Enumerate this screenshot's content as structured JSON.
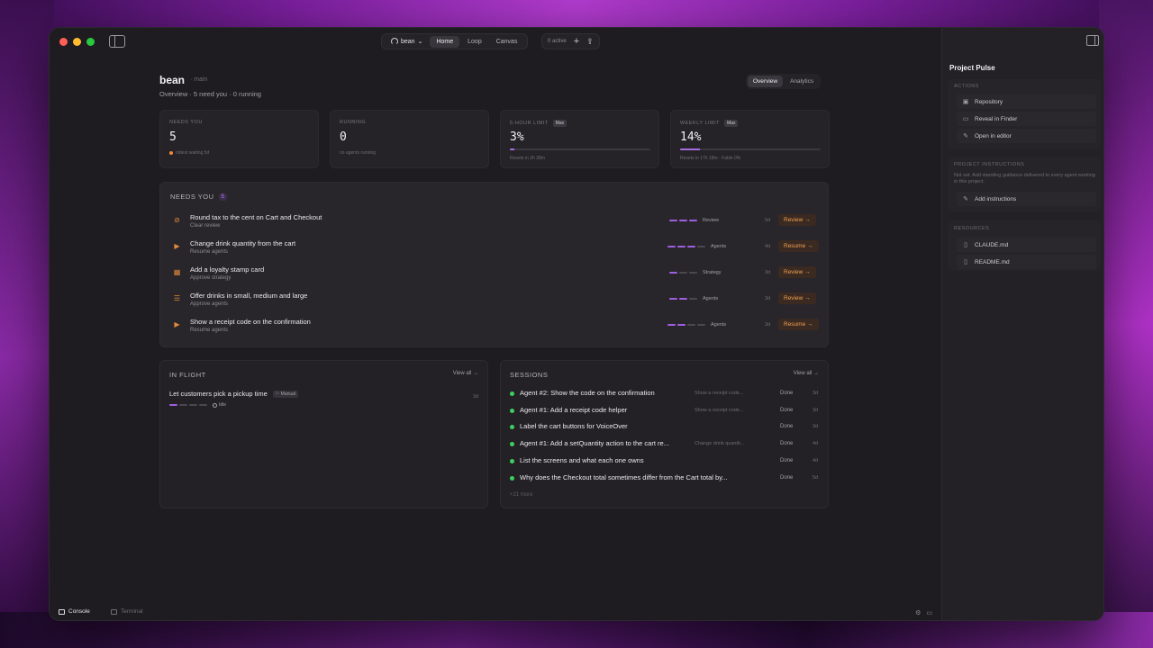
{
  "window": {
    "project": "bean",
    "tabs": [
      "Home",
      "Loop",
      "Canvas"
    ],
    "active_tab": "Home",
    "active_count": "0 active"
  },
  "header": {
    "title": "bean",
    "branch": "· main",
    "subtitle": "Overview · 5 need you · 0 running",
    "segments": [
      "Overview",
      "Analytics"
    ]
  },
  "stats": [
    {
      "label": "NEEDS YOU",
      "value": "5",
      "note": "oldest waiting 5d"
    },
    {
      "label": "RUNNING",
      "value": "0",
      "note": "no agents running"
    },
    {
      "label": "5-HOUR LIMIT",
      "badge": "Max",
      "value": "3%",
      "progress": 0.03,
      "note": "Resets in 2h 38m"
    },
    {
      "label": "WEEKLY LIMIT",
      "badge": "Max",
      "value": "14%",
      "progress": 0.14,
      "note": "Resets in 17h 18m · Fable 0%"
    }
  ],
  "needs_you": {
    "title": "NEEDS YOU",
    "count": "5",
    "items": [
      {
        "title": "Round tax to the cent on Cart and Checkout",
        "sub": "Clear review",
        "stage": "Review",
        "age": "5d",
        "action": "Review →",
        "icon": "check-circle-icon",
        "steps_on": 3,
        "steps": 3
      },
      {
        "title": "Change drink quantity from the cart",
        "sub": "Resume agents",
        "stage": "Agents",
        "age": "4d",
        "action": "Resume →",
        "icon": "play-circle-icon",
        "steps_on": 3,
        "steps": 4
      },
      {
        "title": "Add a loyalty stamp card",
        "sub": "Approve strategy",
        "stage": "Strategy",
        "age": "3d",
        "action": "Review →",
        "icon": "map-icon",
        "steps_on": 1,
        "steps": 3
      },
      {
        "title": "Offer drinks in small, medium and large",
        "sub": "Approve agents",
        "stage": "Agents",
        "age": "3d",
        "action": "Review →",
        "icon": "list-icon",
        "steps_on": 2,
        "steps": 3
      },
      {
        "title": "Show a receipt code on the confirmation",
        "sub": "Resume agents",
        "stage": "Agents",
        "age": "3d",
        "action": "Resume →",
        "icon": "play-circle-icon",
        "steps_on": 2,
        "steps": 4
      }
    ]
  },
  "in_flight": {
    "title": "IN FLIGHT",
    "view_all": "View all →",
    "item": {
      "title": "Let customers pick a pickup time",
      "tag": "Manual",
      "status": "Idle",
      "age": "3d"
    }
  },
  "sessions": {
    "title": "SESSIONS",
    "view_all": "View all →",
    "items": [
      {
        "title": "Agent #2: Show the code on the confirmation",
        "sub": "Show a receipt code...",
        "status": "Done",
        "age": "3d"
      },
      {
        "title": "Agent #1: Add a receipt code helper",
        "sub": "Show a receipt code...",
        "status": "Done",
        "age": "3d"
      },
      {
        "title": "Label the cart buttons for VoiceOver",
        "sub": "",
        "status": "Done",
        "age": "3d"
      },
      {
        "title": "Agent #1: Add a setQuantity action to the cart re...",
        "sub": "Change drink quantit...",
        "status": "Done",
        "age": "4d"
      },
      {
        "title": "List the screens and what each one owns",
        "sub": "",
        "status": "Done",
        "age": "4d"
      },
      {
        "title": "Why does the Checkout total sometimes differ from the Cart total by...",
        "sub": "",
        "status": "Done",
        "age": "5d"
      }
    ],
    "more": "+21 more"
  },
  "footer": {
    "console": "Console",
    "terminal": "Terminal"
  },
  "right_panel": {
    "title": "Project Pulse",
    "actions_h": "ACTIONS",
    "actions": [
      "Repository",
      "Reveal in Finder",
      "Open in editor"
    ],
    "instr_h": "PROJECT INSTRUCTIONS",
    "instr_desc": "Not set. Add standing guidance delivered to every agent working in this project.",
    "instr_btn": "Add instructions",
    "res_h": "RESOURCES",
    "resources": [
      "CLAUDE.md",
      "README.md"
    ]
  },
  "colors": {
    "accent": "#9d5fe0",
    "action": "#f0a050",
    "done": "#3ecf5e"
  }
}
